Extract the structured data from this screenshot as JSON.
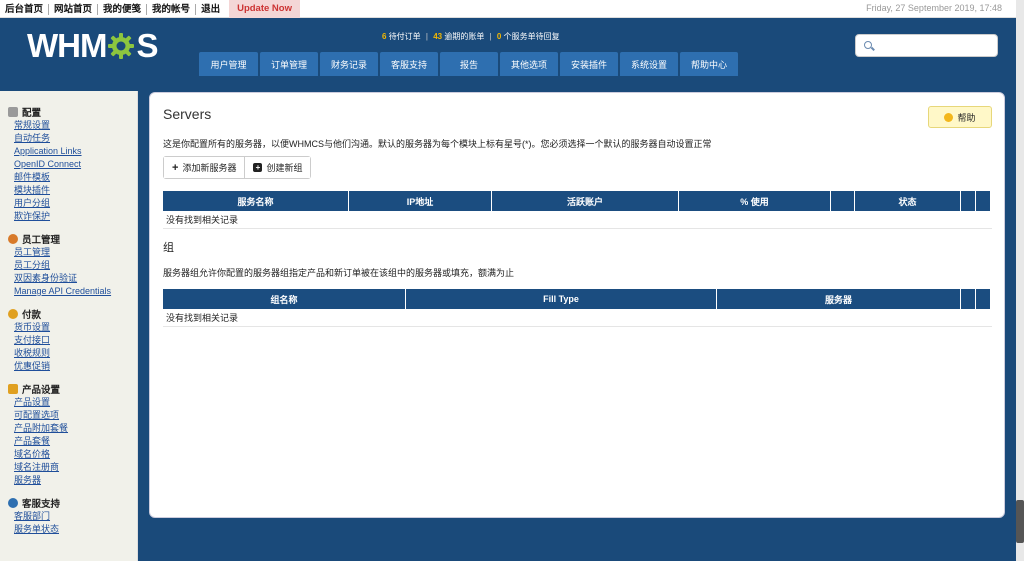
{
  "topbar": {
    "links": [
      "后台首页",
      "网站首页",
      "我的便笺",
      "我的帐号",
      "退出"
    ],
    "update_label": "Update Now",
    "datetime": "Friday, 27 September 2019, 17:48"
  },
  "header": {
    "logo_text_left": "WHM",
    "logo_text_right": "S",
    "stats": {
      "orders_num": "6",
      "orders_label": "待付订单",
      "overdue_num": "43",
      "overdue_label": "逾期的账单",
      "tickets_num": "0",
      "tickets_label": "个服务单待回复"
    },
    "nav": [
      "用户管理",
      "订单管理",
      "财务记录",
      "客服支持",
      "报告",
      "其他选项",
      "安装插件",
      "系统设置",
      "帮助中心"
    ],
    "search_placeholder": ""
  },
  "sidebar": {
    "sections": [
      {
        "title": "配置",
        "icon": "document-icon",
        "icon_color": "#7a7a7a",
        "links": [
          "常规设置",
          "自动任务",
          "Application Links",
          "OpenID Connect",
          "邮件模板",
          "模块插件",
          "用户分组",
          "欺诈保护"
        ]
      },
      {
        "title": "员工管理",
        "icon": "user-icon",
        "icon_color": "#d87a2a",
        "links": [
          "员工管理",
          "员工分组",
          "双因素身份验证",
          "Manage API Credentials"
        ]
      },
      {
        "title": "付款",
        "icon": "coins-icon",
        "icon_color": "#e0a020",
        "links": [
          "货币设置",
          "支付接口",
          "收税规则",
          "优惠促销"
        ]
      },
      {
        "title": "产品设置",
        "icon": "box-icon",
        "icon_color": "#e0a020",
        "links": [
          "产品设置",
          "可配置选项",
          "产品附加套餐",
          "产品套餐",
          "域名价格",
          "域名注册商",
          "服务器"
        ]
      },
      {
        "title": "客服支持",
        "icon": "support-icon",
        "icon_color": "#2e6fb0",
        "links": [
          "客服部门",
          "服务单状态"
        ]
      }
    ]
  },
  "main": {
    "title": "Servers",
    "help_label": "帮助",
    "description": "这是你配置所有的服务器，以便WHMCS与他们沟通。默认的服务器为每个模块上标有星号(*)。您必须选择一个默认的服务器自动设置正常",
    "add_server_label": "添加新服务器",
    "create_group_label": "创建新组",
    "servers_table": {
      "columns": [
        "服务名称",
        "IP地址",
        "活跃账户",
        "% 使用",
        "",
        "状态",
        "",
        ""
      ],
      "empty_text": "没有找到相关记录"
    },
    "groups_title": "组",
    "groups_description": "服务器组允许你配置的服务器组指定产品和新订单被在该组中的服务器或填充，额满为止",
    "groups_table": {
      "columns": [
        "组名称",
        "Fill Type",
        "服务器",
        "",
        ""
      ],
      "empty_text": "没有找到相关记录"
    }
  }
}
